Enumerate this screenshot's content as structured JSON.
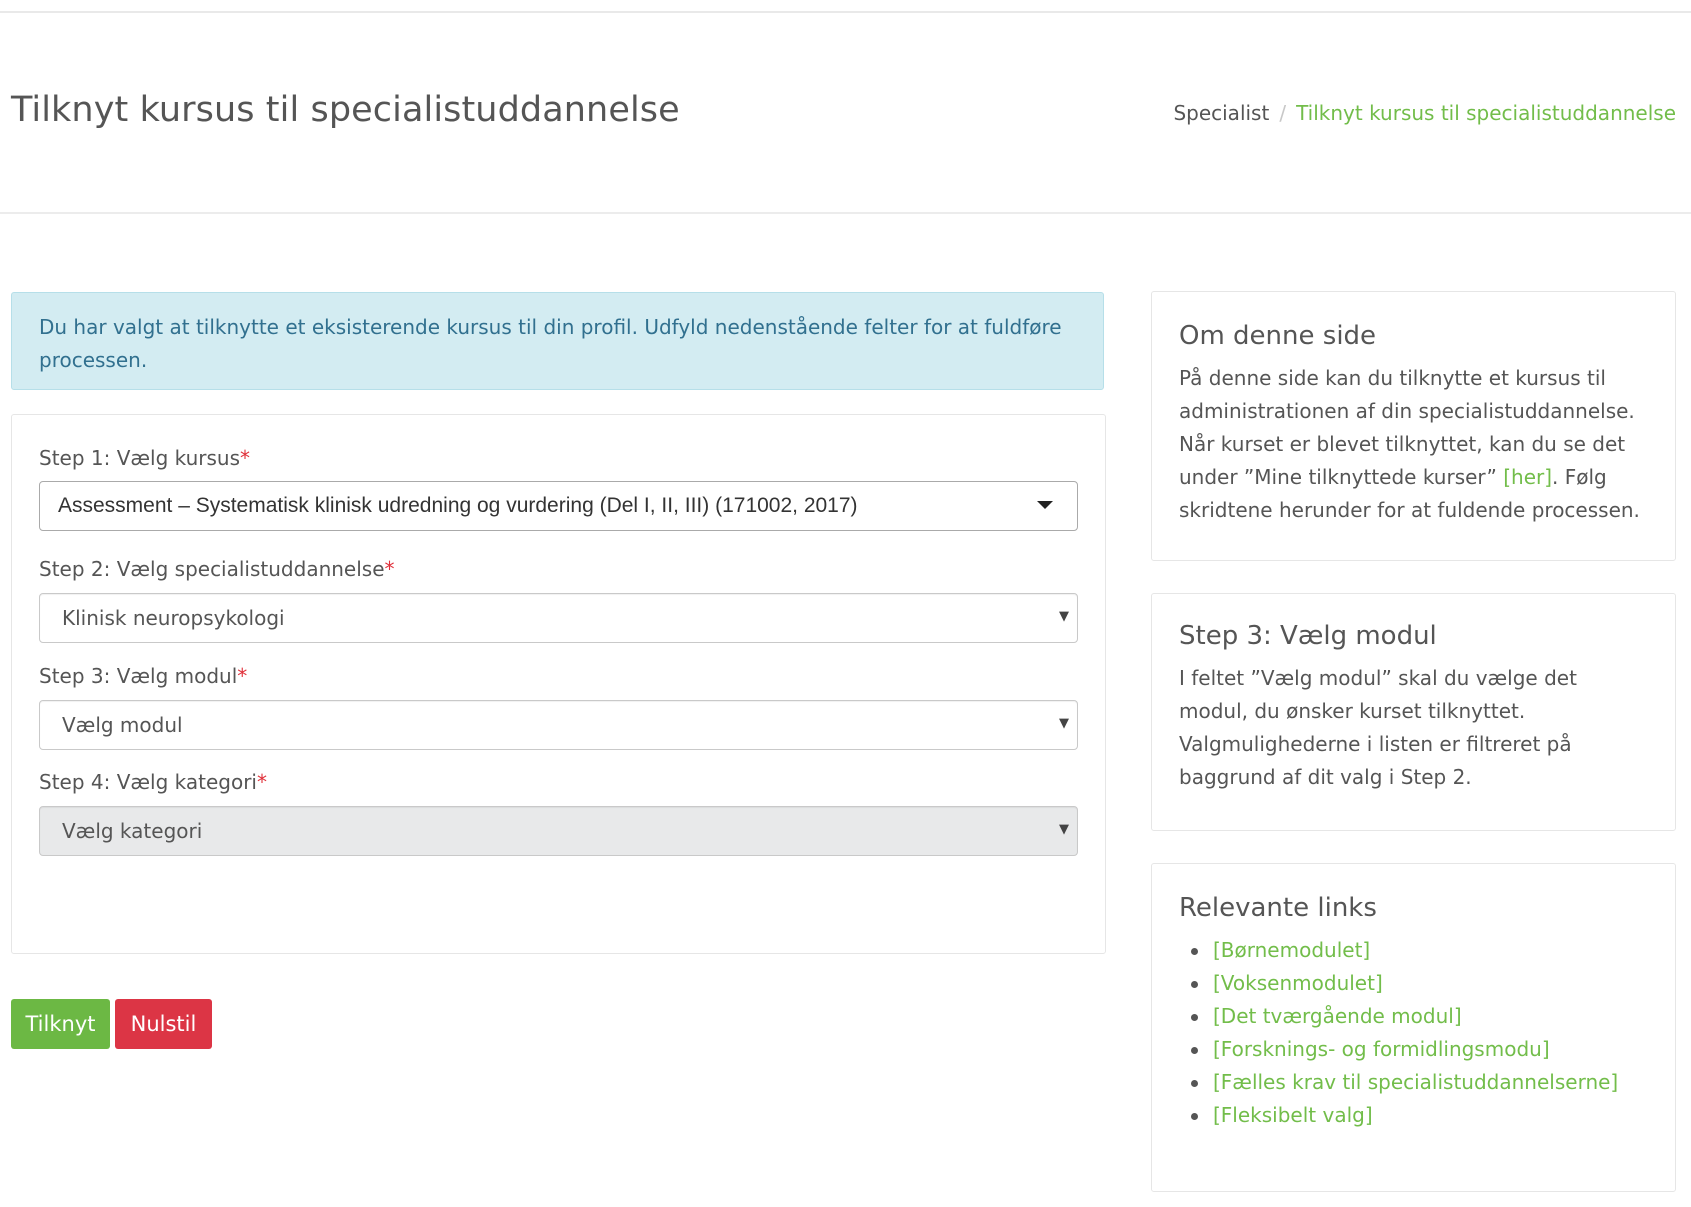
{
  "header": {
    "title": "Tilknyt kursus til specialistuddannelse",
    "breadcrumb": {
      "parent": "Specialist",
      "separator": "/",
      "current": "Tilknyt kursus til specialistuddannelse"
    }
  },
  "alert": {
    "text": "Du har valgt at tilknytte et eksisterende kursus til din profil. Udfyld nedenstående felter for at fuldføre processen."
  },
  "form": {
    "required_mark": "*",
    "step1": {
      "label": "Step 1: Vælg kursus",
      "value": "Assessment – Systematisk klinisk udredning og vurdering (Del I, II, III) (171002, 2017)"
    },
    "step2": {
      "label": "Step 2: Vælg specialistuddannelse",
      "value": "Klinisk neuropsykologi"
    },
    "step3": {
      "label": "Step 3: Vælg modul",
      "value": "Vælg modul"
    },
    "step4": {
      "label": "Step 4: Vælg kategori",
      "value": "Vælg kategori",
      "disabled": true
    }
  },
  "actions": {
    "submit_label": "Tilknyt",
    "reset_label": "Nulstil"
  },
  "sidebar": {
    "about": {
      "title": "Om denne side",
      "text_before_link": "På denne side kan du tilknytte et kursus til administrationen af din specialistuddannelse. Når kurset er blevet tilknyttet, kan du se det under ”Mine tilknyttede kurser” ",
      "link": "[her]",
      "text_after_link": ". Følg skridtene herunder for at fuldende processen."
    },
    "step3": {
      "title": "Step 3: Vælg modul",
      "text": "I feltet ”Vælg modul” skal du vælge det modul, du ønsker kurset tilknyttet. Valgmulighederne i listen er filtreret på baggrund af dit valg i Step 2."
    },
    "links": {
      "title": "Relevante links",
      "items": [
        "[Børnemodulet]",
        "[Voksenmodulet]",
        "[Det tværgående modul]",
        "[Forsknings- og formidlingsmodu]",
        "[Fælles krav til specialistuddannelserne]",
        "[Fleksibelt valg]"
      ]
    }
  },
  "colors": {
    "accent_green": "#72bd4a",
    "button_green": "#6cb844",
    "button_red": "#dc3545",
    "alert_bg": "#d3ecf2",
    "alert_text": "#31708f",
    "required": "#e0303a"
  }
}
